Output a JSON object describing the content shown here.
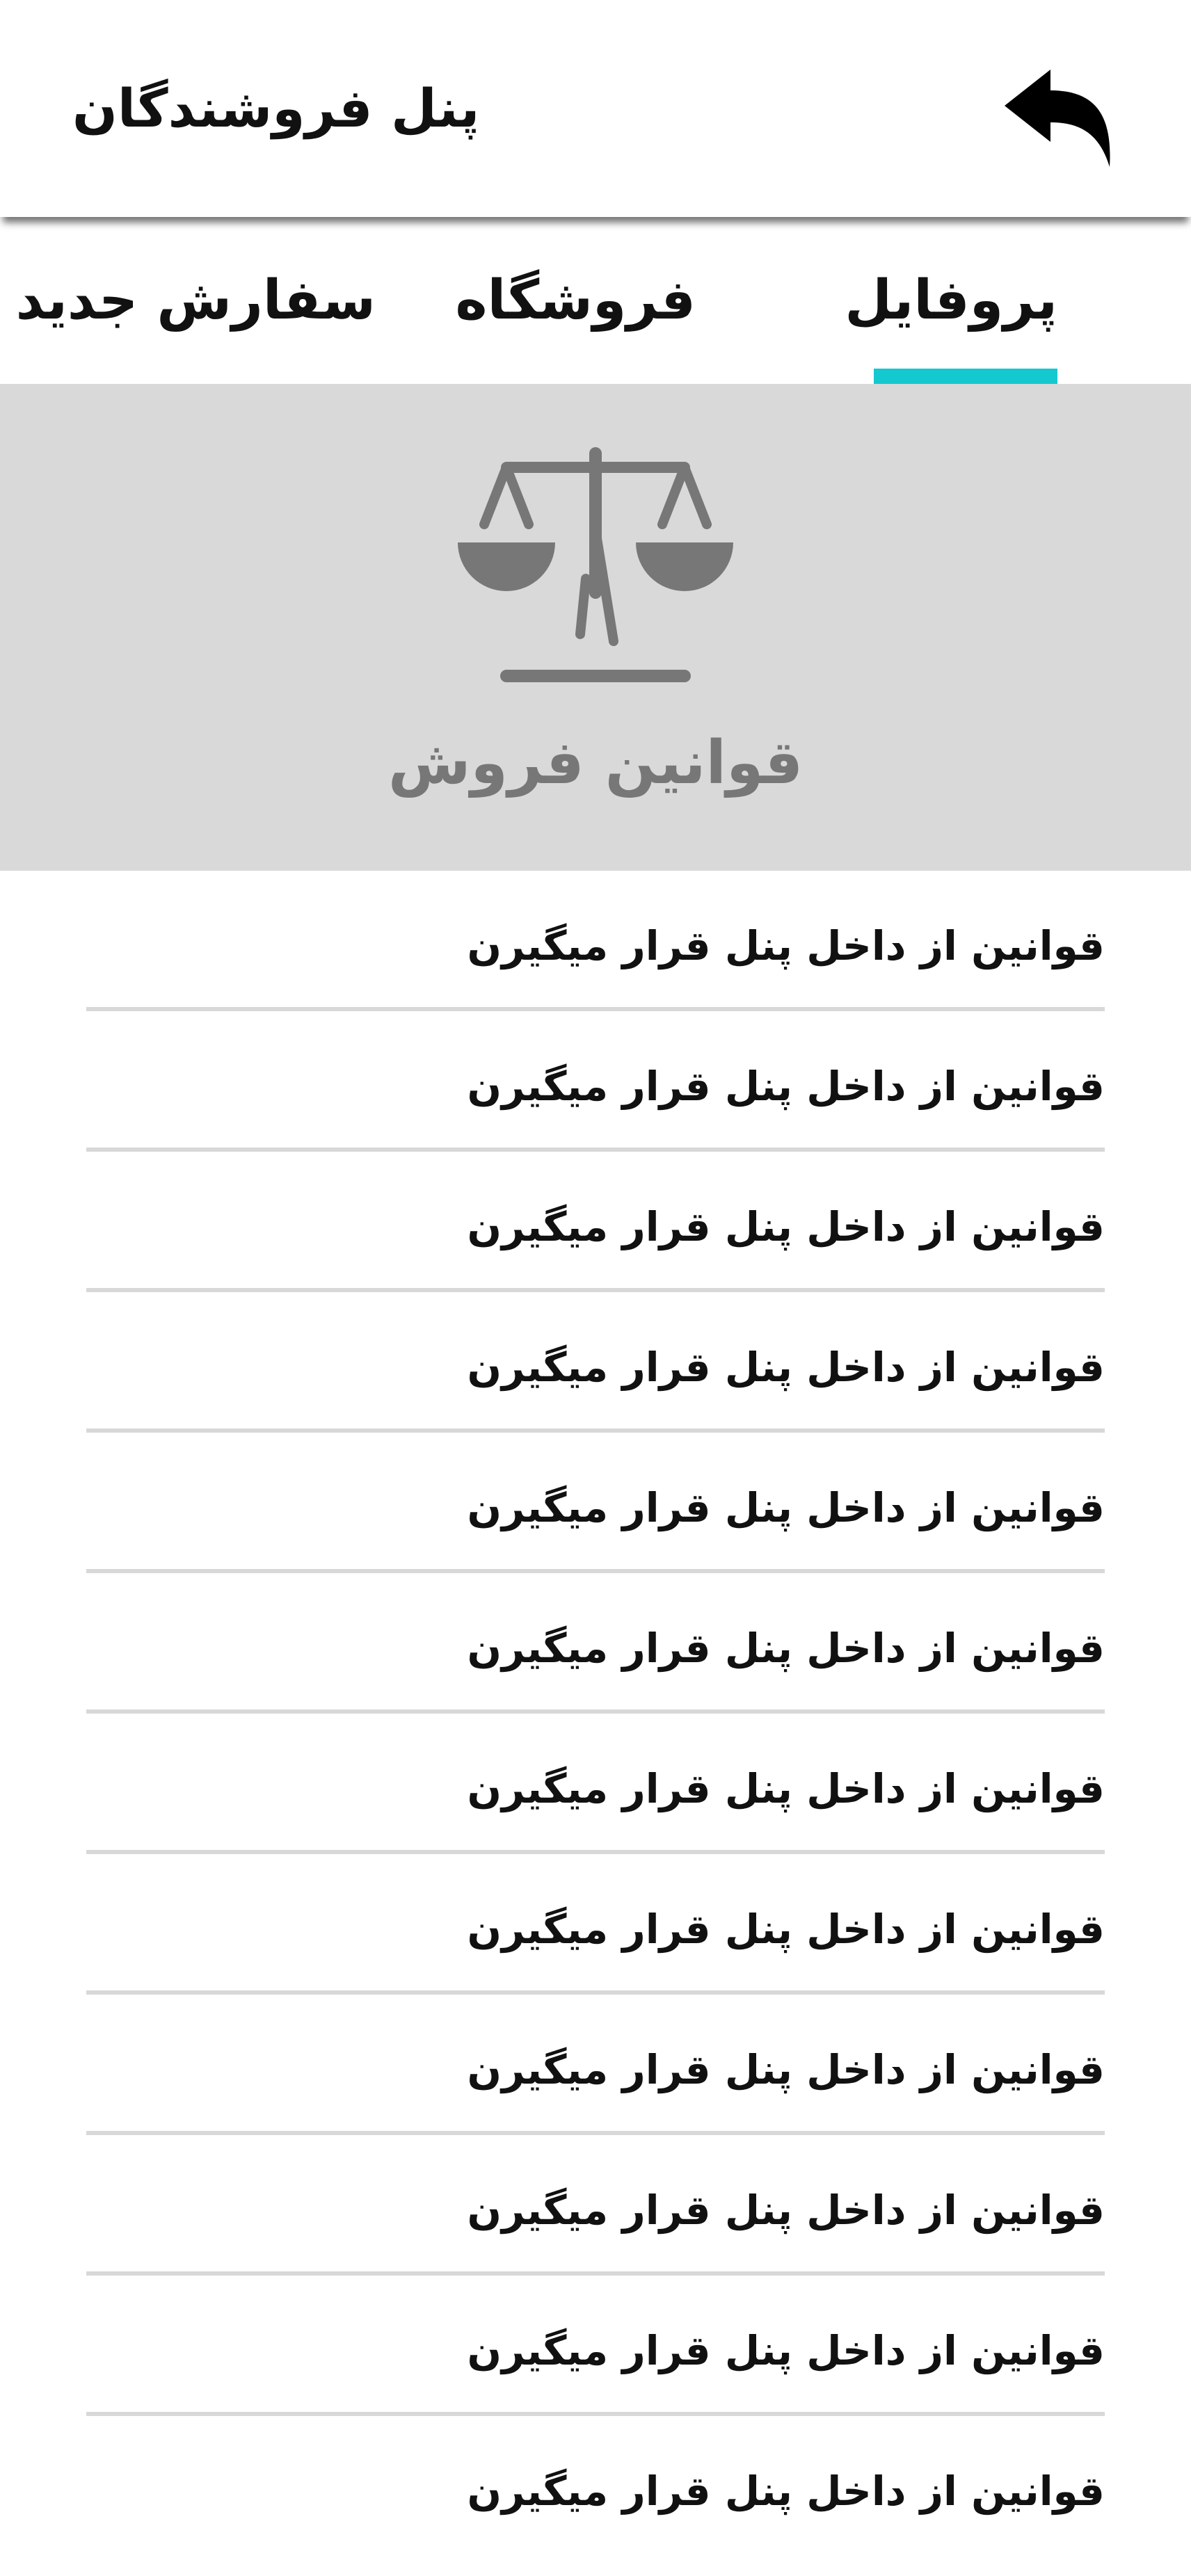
{
  "app_bar": {
    "title": "پنل فروشندگان",
    "back_icon": "back-arrow-icon"
  },
  "tabs": [
    {
      "label": "پروفایل",
      "selected": true
    },
    {
      "label": "فروشگاه",
      "selected": false
    },
    {
      "label": "سفارش جدید",
      "selected": false
    }
  ],
  "banner": {
    "icon": "scale-icon",
    "title": "قوانین فروش"
  },
  "rules": [
    "قوانین از داخل پنل قرار میگیرن",
    "قوانین از داخل پنل قرار میگیرن",
    "قوانین از داخل پنل قرار میگیرن",
    "قوانین از داخل پنل قرار میگیرن",
    "قوانین از داخل پنل قرار میگیرن",
    "قوانین از داخل پنل قرار میگیرن",
    "قوانین از داخل پنل قرار میگیرن",
    "قوانین از داخل پنل قرار میگیرن",
    "قوانین از داخل پنل قرار میگیرن",
    "قوانین از داخل پنل قرار میگیرن",
    "قوانین از داخل پنل قرار میگیرن",
    "قوانین از داخل پنل قرار میگیرن"
  ],
  "colors": {
    "accent": "#14c8d0",
    "banner_background": "#d9d9d9",
    "icon_gray": "#777777",
    "divider": "#d8d8d8"
  }
}
